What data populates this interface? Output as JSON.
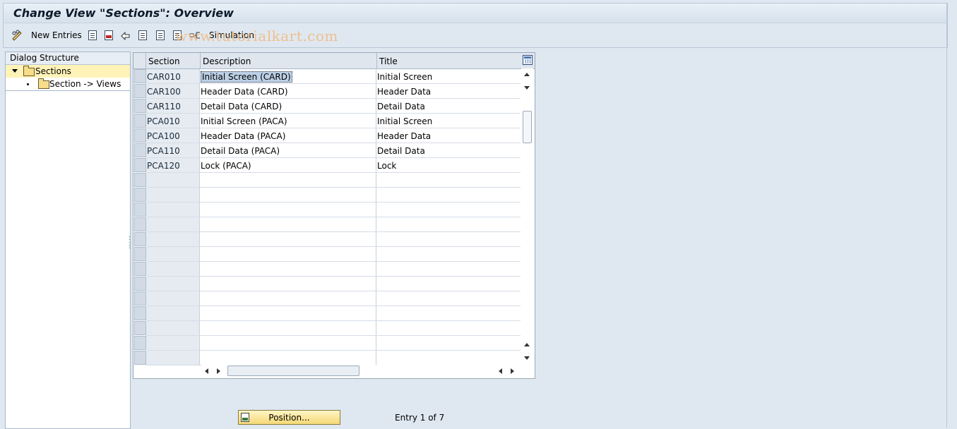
{
  "window": {
    "title": "Change View \"Sections\": Overview"
  },
  "toolbar": {
    "new_entries_label": "New Entries",
    "simulation_label": "Simulation",
    "watermark": "www.tutorialkart.com"
  },
  "dialog_structure": {
    "heading": "Dialog Structure",
    "items": [
      {
        "label": "Sections",
        "selected": true,
        "expanded": true
      },
      {
        "label": "Section -> Views",
        "selected": false
      }
    ]
  },
  "table": {
    "columns": [
      "Section",
      "Description",
      "Title"
    ],
    "rows": [
      {
        "section": "CAR010",
        "description": "Initial Screen (CARD)",
        "title": "Initial Screen"
      },
      {
        "section": "CAR100",
        "description": "Header Data (CARD)",
        "title": "Header Data"
      },
      {
        "section": "CAR110",
        "description": "Detail Data (CARD)",
        "title": "Detail Data"
      },
      {
        "section": "PCA010",
        "description": "Initial Screen (PACA)",
        "title": "Initial Screen"
      },
      {
        "section": "PCA100",
        "description": "Header Data (PACA)",
        "title": "Header Data"
      },
      {
        "section": "PCA110",
        "description": "Detail Data (PACA)",
        "title": "Detail Data"
      },
      {
        "section": "PCA120",
        "description": "Lock (PACA)",
        "title": "Lock"
      }
    ]
  },
  "footer": {
    "position_button": "Position...",
    "entry_status": "Entry 1 of 7"
  },
  "colors": {
    "selected_tree_item": "#fff3b8",
    "position_button": "#f4d876",
    "watermark": "#f2b97a"
  }
}
